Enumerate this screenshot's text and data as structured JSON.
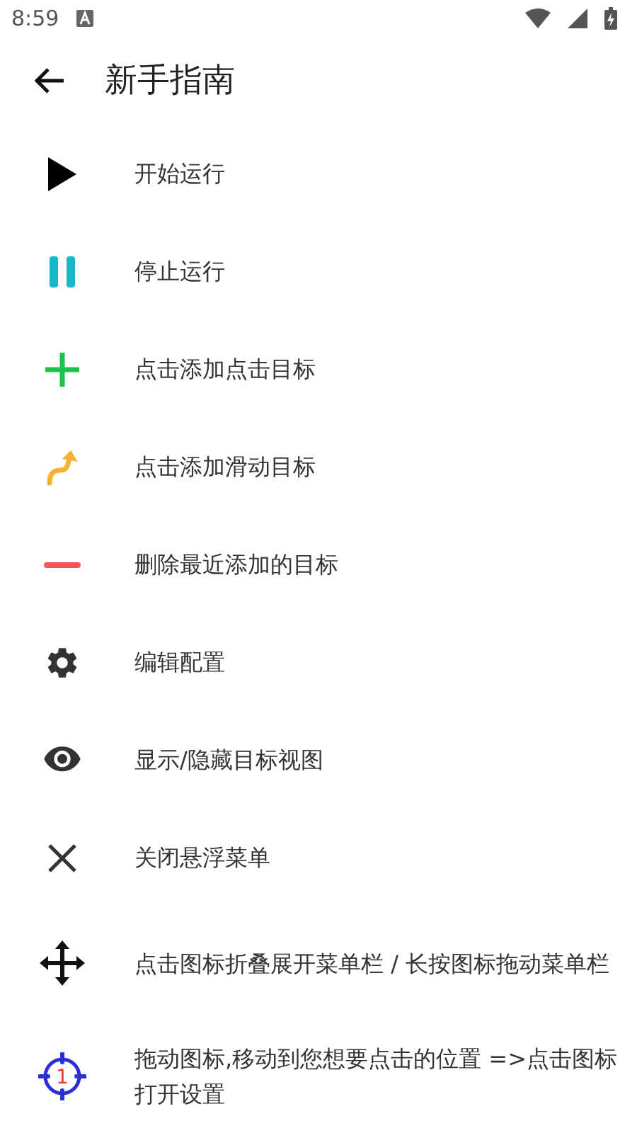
{
  "status_bar": {
    "time": "8:59"
  },
  "app_bar": {
    "title": "新手指南"
  },
  "items": [
    {
      "kind": "play",
      "label": "开始运行"
    },
    {
      "kind": "pause",
      "label": "停止运行"
    },
    {
      "kind": "plus",
      "label": "点击添加点击目标"
    },
    {
      "kind": "swipe",
      "label": "点击添加滑动目标"
    },
    {
      "kind": "minus",
      "label": "删除最近添加的目标"
    },
    {
      "kind": "gear",
      "label": "编辑配置"
    },
    {
      "kind": "eye",
      "label": "显示/隐藏目标视图"
    },
    {
      "kind": "close",
      "label": "关闭悬浮菜单"
    },
    {
      "kind": "move",
      "label": "点击图标折叠展开菜单栏 / 长按图标拖动菜单栏"
    },
    {
      "kind": "target",
      "label": "拖动图标,移动到您想要点击的位置 =>点击图标打开设置",
      "badge": "1"
    }
  ]
}
